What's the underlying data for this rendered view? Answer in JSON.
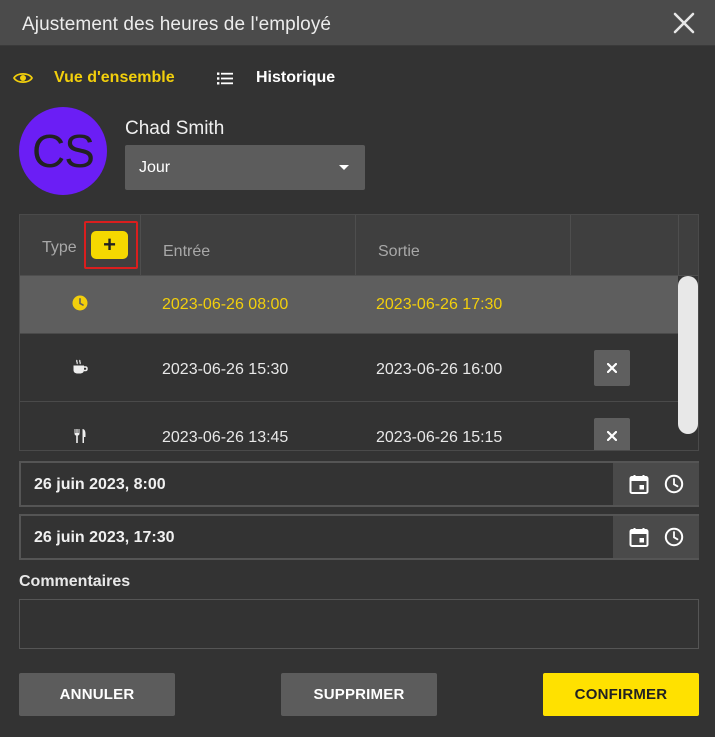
{
  "dialog": {
    "title": "Ajustement des heures de l'employé"
  },
  "tabs": [
    {
      "label": "Vue d'ensemble",
      "icon": "eye-icon",
      "active": true
    },
    {
      "label": "Historique",
      "icon": "list-icon",
      "active": false
    }
  ],
  "employee": {
    "initials": "CS",
    "name": "Chad Smith",
    "period": "Jour"
  },
  "table": {
    "headers": {
      "type": "Type",
      "add": "+",
      "entry": "Entrée",
      "exit": "Sortie"
    },
    "rows": [
      {
        "type_icon": "clock-icon",
        "entry": "2023-06-26 08:00",
        "exit": "2023-06-26 17:30",
        "selected": true
      },
      {
        "type_icon": "coffee-icon",
        "entry": "2023-06-26 15:30",
        "exit": "2023-06-26 16:00",
        "selected": false
      },
      {
        "type_icon": "utensils-icon",
        "entry": "2023-06-26 13:45",
        "exit": "2023-06-26 15:15",
        "selected": false
      }
    ]
  },
  "fields": {
    "start": "26 juin 2023, 8:00",
    "end": "26 juin 2023, 17:30",
    "comments_label": "Commentaires",
    "comments_value": ""
  },
  "buttons": {
    "cancel": "ANNULER",
    "delete": "SUPPRIMER",
    "confirm": "CONFIRMER"
  },
  "colors": {
    "accent": "#f5d800",
    "avatar": "#6b1ef5",
    "highlight": "#d91e1e"
  }
}
